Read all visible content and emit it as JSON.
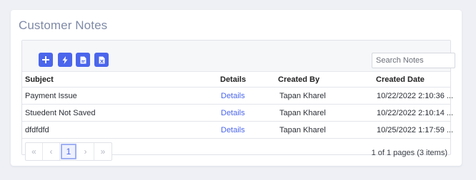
{
  "card": {
    "title": "Customer Notes"
  },
  "toolbar": {
    "buttons": [
      {
        "name": "add-button",
        "icon": "plus-icon"
      },
      {
        "name": "quick-action-button",
        "icon": "lightning-icon"
      },
      {
        "name": "export-pdf-button",
        "icon": "pdf-file-icon"
      },
      {
        "name": "export-excel-button",
        "icon": "excel-file-icon"
      }
    ],
    "search_placeholder": "Search Notes"
  },
  "columns": {
    "subject": "Subject",
    "details": "Details",
    "created_by": "Created By",
    "created_date": "Created Date"
  },
  "rows": [
    {
      "subject": "Payment Issue",
      "details": "Details",
      "created_by": "Tapan Kharel",
      "created_date": "10/22/2022 2:10:36 ..."
    },
    {
      "subject": "Stuedent Not Saved",
      "details": "Details",
      "created_by": "Tapan Kharel",
      "created_date": "10/22/2022 2:10:14 ..."
    },
    {
      "subject": "dfdfdfd",
      "details": "Details",
      "created_by": "Tapan Kharel",
      "created_date": "10/25/2022 1:17:59 ..."
    }
  ],
  "pager": {
    "first": "«",
    "prev": "‹",
    "current_page": "1",
    "next": "›",
    "last": "»",
    "info": "1 of 1 pages (3 items)"
  },
  "colors": {
    "accent": "#4b66ec",
    "title": "#7f8aa7"
  }
}
